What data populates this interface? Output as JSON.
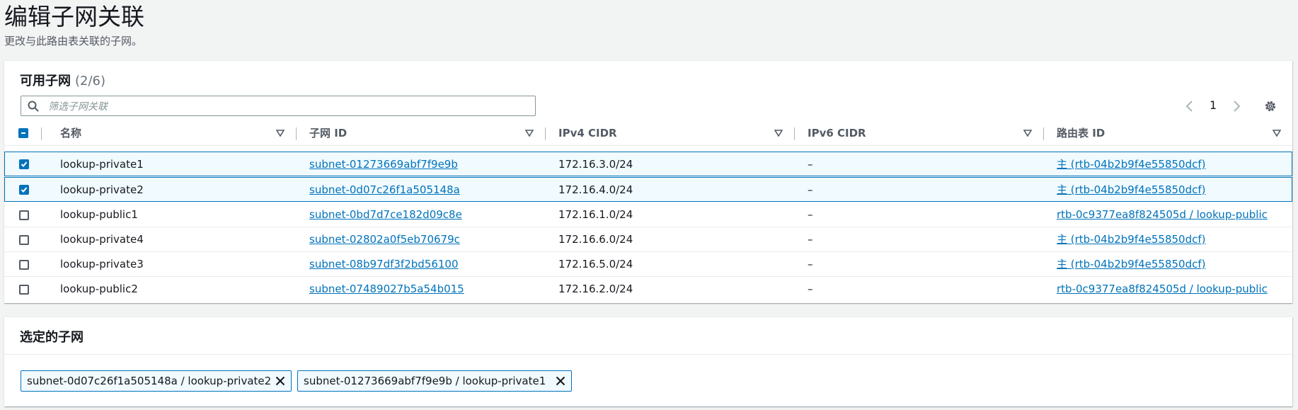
{
  "page": {
    "title": "编辑子网关联",
    "subtitle": "更改与此路由表关联的子网。"
  },
  "available": {
    "heading": "可用子网",
    "count": "(2/6)",
    "search_placeholder": "筛选子网关联",
    "page_number": "1",
    "columns": [
      "名称",
      "子网 ID",
      "IPv4 CIDR",
      "IPv6 CIDR",
      "路由表 ID"
    ],
    "rows": [
      {
        "name": "lookup-private1",
        "subnet_id": "subnet-01273669abf7f9e9b",
        "ipv4": "172.16.3.0/24",
        "ipv6": "–",
        "route_table": "主 (rtb-04b2b9f4e55850dcf)",
        "checked": true
      },
      {
        "name": "lookup-private2",
        "subnet_id": "subnet-0d07c26f1a505148a",
        "ipv4": "172.16.4.0/24",
        "ipv6": "–",
        "route_table": "主 (rtb-04b2b9f4e55850dcf)",
        "checked": true
      },
      {
        "name": "lookup-public1",
        "subnet_id": "subnet-0bd7d7ce182d09c8e",
        "ipv4": "172.16.1.0/24",
        "ipv6": "–",
        "route_table": "rtb-0c9377ea8f824505d / lookup-public",
        "checked": false
      },
      {
        "name": "lookup-private4",
        "subnet_id": "subnet-02802a0f5eb70679c",
        "ipv4": "172.16.6.0/24",
        "ipv6": "–",
        "route_table": "主 (rtb-04b2b9f4e55850dcf)",
        "checked": false
      },
      {
        "name": "lookup-private3",
        "subnet_id": "subnet-08b97df3f2bd56100",
        "ipv4": "172.16.5.0/24",
        "ipv6": "–",
        "route_table": "主 (rtb-04b2b9f4e55850dcf)",
        "checked": false
      },
      {
        "name": "lookup-public2",
        "subnet_id": "subnet-07489027b5a54b015",
        "ipv4": "172.16.2.0/24",
        "ipv6": "–",
        "route_table": "rtb-0c9377ea8f824505d / lookup-public",
        "checked": false
      }
    ]
  },
  "selected": {
    "heading": "选定的子网",
    "tokens": [
      "subnet-0d07c26f1a505148a / lookup-private2",
      "subnet-01273669abf7f9e9b / lookup-private1"
    ]
  },
  "colors": {
    "accent": "#0073bb",
    "selected_row_bg": "#f1faff",
    "background": "#f2f3f3"
  }
}
